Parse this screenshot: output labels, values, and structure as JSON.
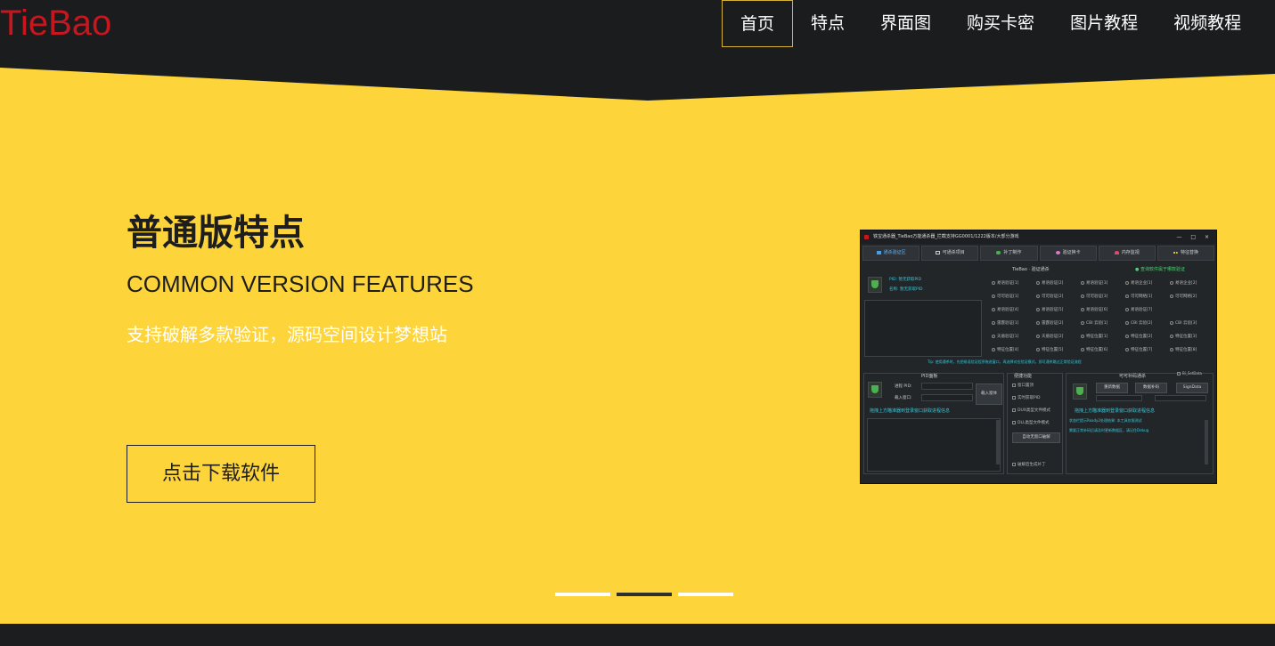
{
  "header": {
    "logo": "TieBao",
    "nav": [
      {
        "label": "首页",
        "active": true
      },
      {
        "label": "特点",
        "active": false
      },
      {
        "label": "界面图",
        "active": false
      },
      {
        "label": "购买卡密",
        "active": false
      },
      {
        "label": "图片教程",
        "active": false
      },
      {
        "label": "视频教程",
        "active": false
      }
    ]
  },
  "hero": {
    "title_cn": "普通版特点",
    "title_en": "COMMON VERSION FEATURES",
    "description": "支持破解多款验证，源码空间设计梦想站",
    "download_button": "点击下载软件"
  },
  "carousel": {
    "slides": 3,
    "active_index": 1
  },
  "app_screenshot": {
    "title": "铁宝通杀器_TieBao万能通杀器_拦截支持GG0001/1222版本/大部分游戏",
    "window_controls": "— □ ×",
    "tabs": [
      "通杀验证区",
      "可通杀项目",
      "补丁制作",
      "验证换卡",
      "内存监视",
      "特征替换"
    ],
    "verify_title": "TieBao · 验证通杀",
    "query_label": "● 查询软件属于哪款验证",
    "pid_label": "PID: 暂无获取PID",
    "name_label": "名称: 暂无获取PID",
    "options": [
      "易语验证[1]",
      "易语验证[2]",
      "易语验证[3]",
      "易语企业[1]",
      "易语企业[2]",
      "可可验证[1]",
      "可可验证[2]",
      "可可验证[3]",
      "可可网络[1]",
      "可可网络[2]",
      "易语验证[4]",
      "易语验证[5]",
      "易语验证[6]",
      "易语验证[7]",
      "",
      "雷霆验证[1]",
      "雷霆验证[2]",
      "CBI 云验[1]",
      "CBI 云验[2]",
      "CBI 云验[3]",
      "天盾验证[1]",
      "天盾验证[2]",
      "特征位置[1]",
      "特征位置[2]",
      "特征位置[3]",
      "特征位置[4]",
      "特征位置[5]",
      "特征位置[6]",
      "特征位置[7]",
      "特征位置[8]"
    ],
    "tip": "Tip: 使用通杀时，先把易语验证程序拖进窗口，再选择对应验证模式，即可通杀跳过正常验证流程",
    "pid_panel": {
      "title": "PID面板",
      "process_label": "进程 PID:",
      "window_label": "载入窗口:",
      "load_button": "载入窗体",
      "hint": "拖拽上方瞄准器到登录窗口获取进程信息"
    },
    "quick": {
      "title": "便捷功能",
      "items": [
        "窗口置顶",
        "实时获取PID",
        "DUX类型文件模式",
        "DLL类型文件模式"
      ],
      "button": "自动无窗口破解",
      "bottom": "破解后生成补丁"
    },
    "right": {
      "title": "可可补码通杀",
      "buttons": [
        "重新数据",
        "数据补码",
        "SignData"
      ],
      "checkbox": "Bi_SetData",
      "hint": "拖拽上方瞄准器到登录窗口获取进程信息",
      "log1": "状态栏提示Ready2处理结果: 本工具仅限测试",
      "log2": "需要正常补码后请及时更新数据区，请记住Debug"
    }
  }
}
